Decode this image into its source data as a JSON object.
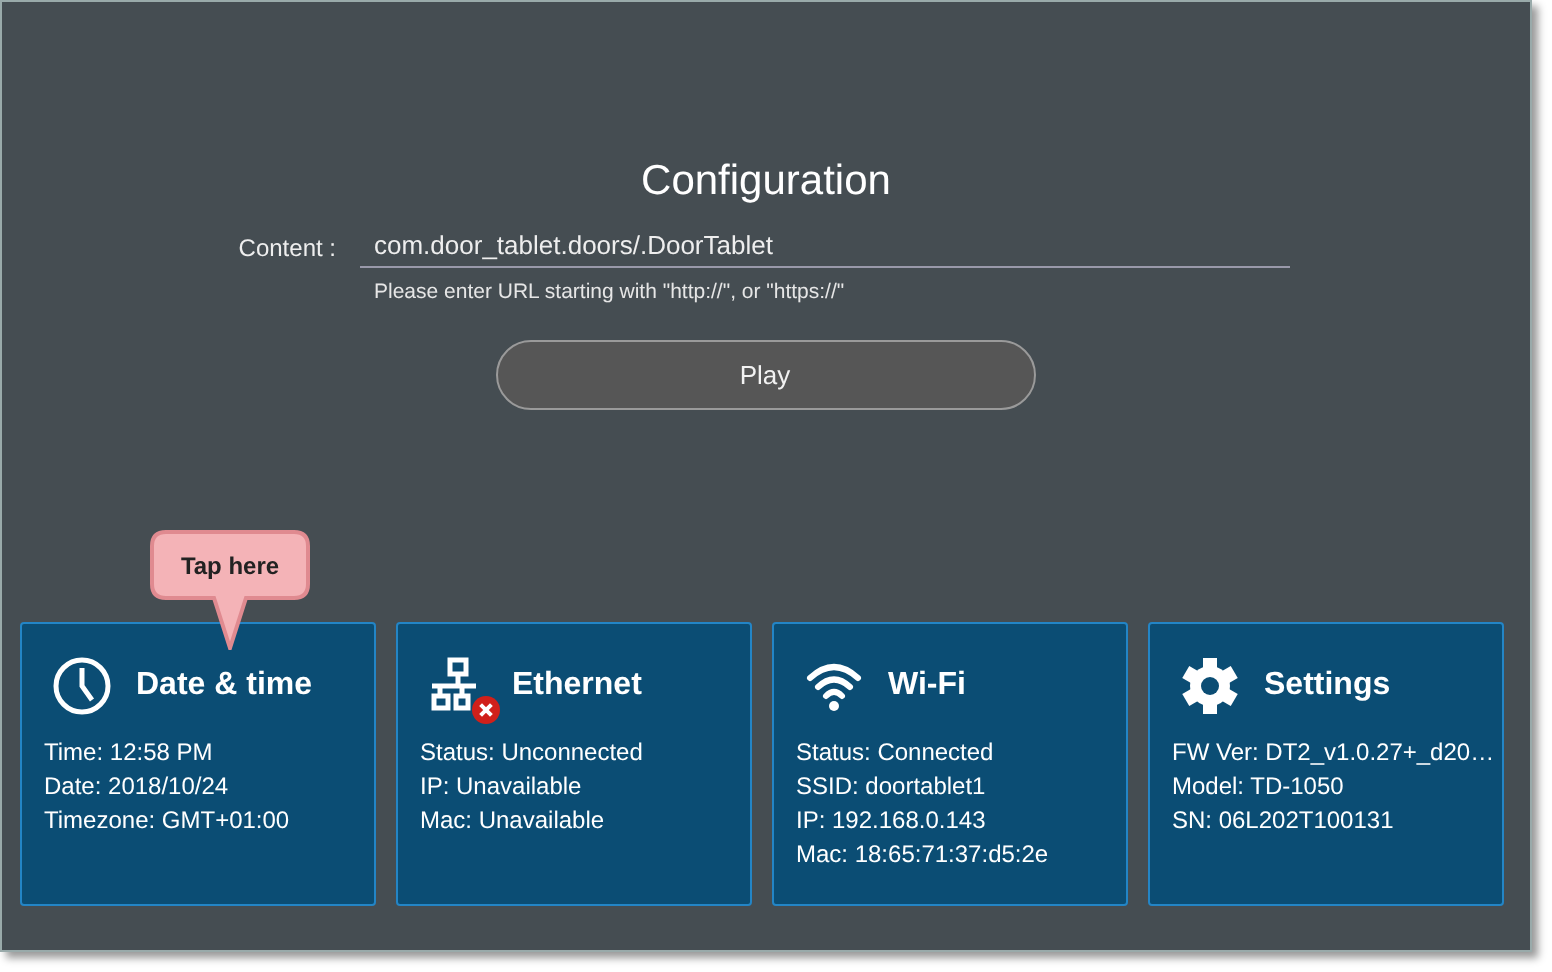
{
  "title": "Configuration",
  "content_field": {
    "label": "Content :",
    "value": "com.door_tablet.doors/.DoorTablet",
    "hint": "Please enter URL starting with \"http://\", or \"https://\""
  },
  "play_button": "Play",
  "callout": "Tap here",
  "cards": [
    {
      "kind": "clock",
      "title": "Date & time",
      "error": false,
      "lines": [
        "Time: 12:58 PM",
        "Date: 2018/10/24",
        "Timezone: GMT+01:00"
      ]
    },
    {
      "kind": "network",
      "title": "Ethernet",
      "error": true,
      "lines": [
        "Status: Unconnected",
        "IP: Unavailable",
        "Mac: Unavailable"
      ]
    },
    {
      "kind": "wifi",
      "title": "Wi-Fi",
      "error": false,
      "lines": [
        "Status: Connected",
        "SSID: doortablet1",
        "IP: 192.168.0.143",
        "Mac: 18:65:71:37:d5:2e"
      ]
    },
    {
      "kind": "gear",
      "title": "Settings",
      "error": false,
      "lines": [
        "FW Ver: DT2_v1.0.27+_d20…",
        "Model: TD-1050",
        "SN: 06L202T100131"
      ]
    }
  ]
}
